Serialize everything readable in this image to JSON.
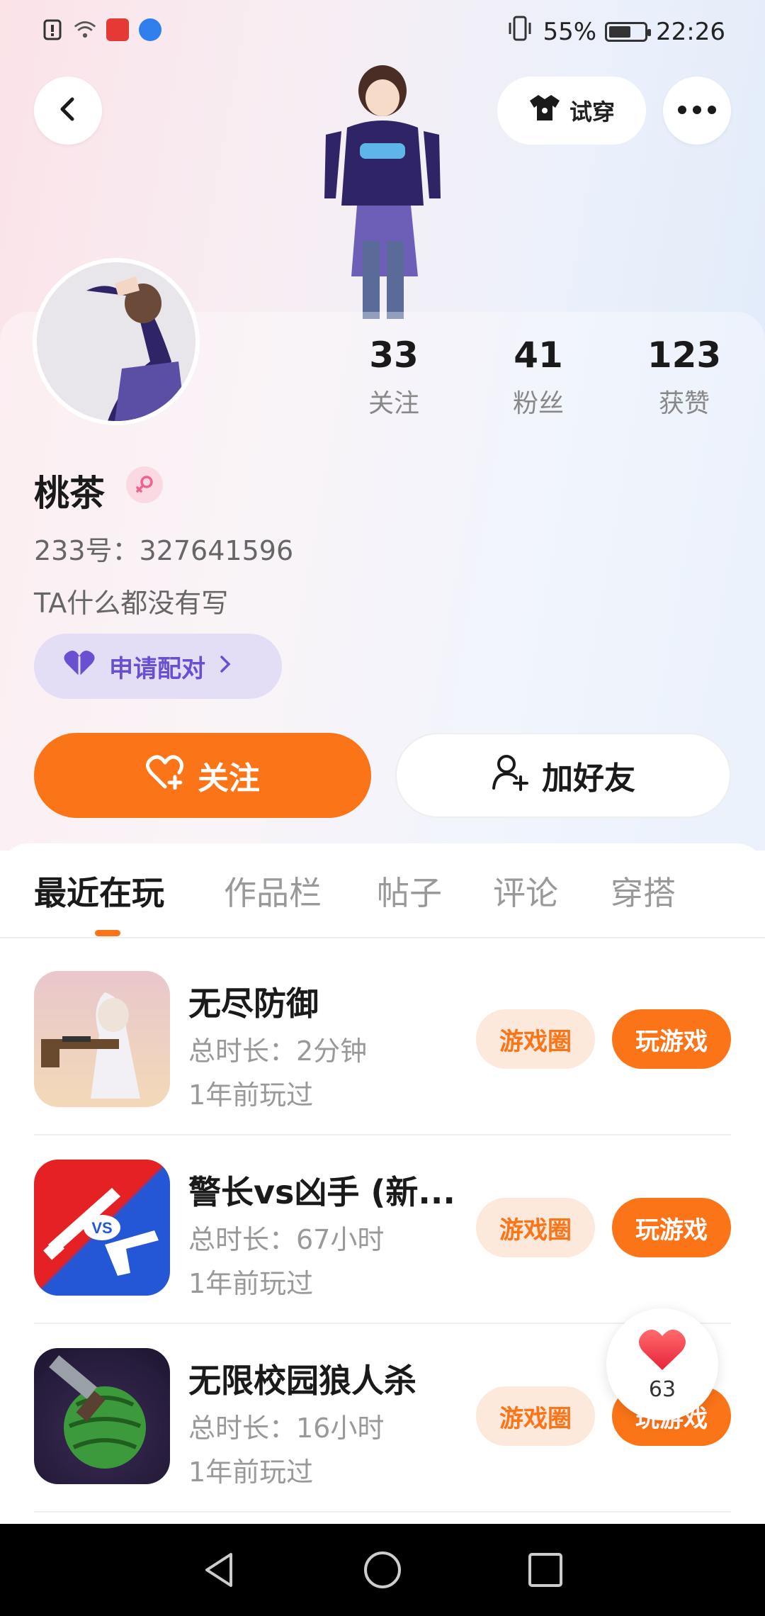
{
  "status_bar": {
    "battery": "55%",
    "time": "22:26",
    "icons": [
      "alert-icon",
      "wifi-icon",
      "huawei-app-icon",
      "browser-icon"
    ]
  },
  "header": {
    "try_on_label": "试穿",
    "icons": {
      "back": "chevron-left-icon",
      "more": "more-dots-icon",
      "tryon": "tshirt-icon"
    }
  },
  "profile": {
    "stats": [
      {
        "value": "33",
        "label": "关注"
      },
      {
        "value": "41",
        "label": "粉丝"
      },
      {
        "value": "123",
        "label": "获赞"
      }
    ],
    "nickname": "桃茶",
    "gender": "female-icon",
    "uid": "233号：327641596",
    "bio": "TA什么都没有写",
    "pair_label": "申请配对",
    "follow_label": "关注",
    "add_friend_label": "加好友"
  },
  "tabs": [
    {
      "label": "最近在玩",
      "active": true
    },
    {
      "label": "作品栏",
      "active": false
    },
    {
      "label": "帖子",
      "active": false
    },
    {
      "label": "评论",
      "active": false
    },
    {
      "label": "穿搭",
      "active": false
    }
  ],
  "games": [
    {
      "title": "无尽防御",
      "duration": "总时长：2分钟",
      "last_played": "1年前玩过",
      "circle_label": "游戏圈",
      "play_label": "玩游戏"
    },
    {
      "title": "警长vs凶手 (新...",
      "duration": "总时长：67小时",
      "last_played": "1年前玩过",
      "circle_label": "游戏圈",
      "play_label": "玩游戏"
    },
    {
      "title": "无限校园狼人杀",
      "duration": "总时长：16小时",
      "last_played": "1年前玩过",
      "circle_label": "游戏圈",
      "play_label": "玩游戏"
    }
  ],
  "like_float": {
    "count": "63"
  },
  "colors": {
    "accent": "#fb7418",
    "pair": "#6a4fd1",
    "pair_bg": "#e4ddf6"
  }
}
